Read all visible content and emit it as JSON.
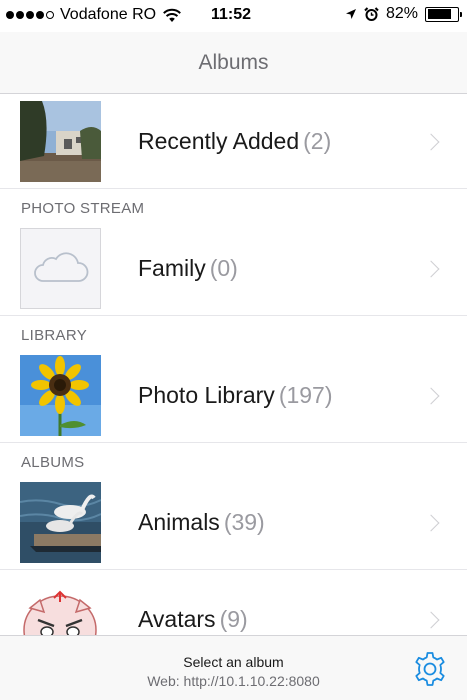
{
  "status_bar": {
    "carrier": "Vodafone RO",
    "time": "11:52",
    "battery_percent": "82%",
    "battery_level": 0.82,
    "signal_bars": 4,
    "icons": [
      "wifi-icon",
      "location-arrow-icon",
      "alarm-icon",
      "battery-icon"
    ]
  },
  "nav": {
    "title": "Albums"
  },
  "sections": {
    "photo_stream": "PHOTO STREAM",
    "library": "LIBRARY",
    "albums": "ALBUMS"
  },
  "albums": [
    {
      "name": "Recently Added",
      "count": "(2)"
    },
    {
      "name": "Family",
      "count": "(0)"
    },
    {
      "name": "Photo Library",
      "count": "(197)"
    },
    {
      "name": "Animals",
      "count": "(39)"
    },
    {
      "name": "Avatars",
      "count": "(9)"
    }
  ],
  "toolbar": {
    "title": "Select an album",
    "subtitle": "Web: http://10.1.10.22:8080",
    "settings_icon": "gear-icon"
  },
  "colors": {
    "accent": "#1a8ce0",
    "secondary_text": "#6d6d72",
    "count_text": "#9a9aa0"
  }
}
